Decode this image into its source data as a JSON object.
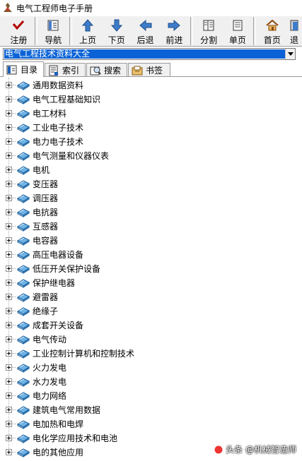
{
  "window": {
    "title": "电气工程师电子手册"
  },
  "toolbar": {
    "buttons": [
      {
        "label": "注册",
        "icon": "checkmark-icon"
      },
      {
        "label": "导航",
        "icon": "navigation-icon"
      },
      {
        "label": "上页",
        "icon": "arrow-up-icon"
      },
      {
        "label": "下页",
        "icon": "arrow-down-icon"
      },
      {
        "label": "后退",
        "icon": "arrow-left-icon"
      },
      {
        "label": "前进",
        "icon": "arrow-right-icon"
      },
      {
        "label": "分割",
        "icon": "split-view-icon"
      },
      {
        "label": "单页",
        "icon": "single-page-icon"
      },
      {
        "label": "首页",
        "icon": "home-icon"
      },
      {
        "label": "退",
        "icon": "exit-icon"
      }
    ]
  },
  "combo": {
    "selected": "电气工程技术资料大全"
  },
  "tabs": [
    {
      "label": "目录",
      "active": true
    },
    {
      "label": "索引",
      "active": false
    },
    {
      "label": "搜索",
      "active": false
    },
    {
      "label": "书签",
      "active": false
    }
  ],
  "tree": {
    "items": [
      "通用数据资料",
      "电气工程基础知识",
      "电工材料",
      "工业电子技术",
      "电力电子技术",
      "电气测量和仪器仪表",
      "电机",
      "变压器",
      "调压器",
      "电抗器",
      "互感器",
      "电容器",
      "高压电器设备",
      "低压开关保护设备",
      "保护继电器",
      "避雷器",
      "绝缘子",
      "成套开关设备",
      "电气传动",
      "工业控制计算机和控制技术",
      "火力发电",
      "水力发电",
      "电力网络",
      "建筑电气常用数据",
      "电加热和电焊",
      "电化学应用技术和电池",
      "电的其他应用"
    ]
  },
  "watermark": {
    "text": "头条 @机械智造师"
  }
}
